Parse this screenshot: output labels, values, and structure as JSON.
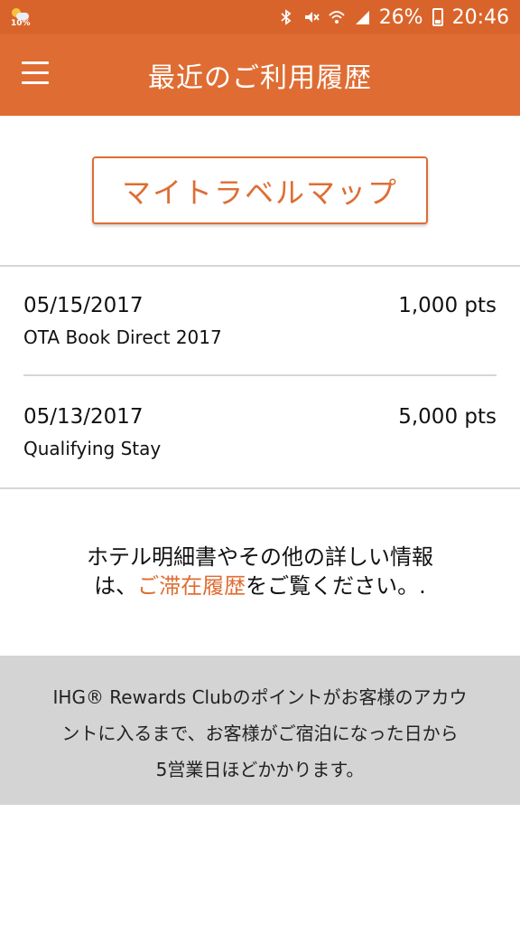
{
  "status_bar": {
    "weather_temp": "10%",
    "battery": "26%",
    "time": "20:46",
    "icons": [
      "weather-icon",
      "bluetooth-icon",
      "mute-icon",
      "wifi-icon",
      "signal-icon",
      "battery-icon"
    ]
  },
  "app_bar": {
    "title": "最近のご利用履歴",
    "menu_icon": "hamburger-menu-icon"
  },
  "map_button": {
    "label": "マイトラベルマップ"
  },
  "history": [
    {
      "date": "05/15/2017",
      "points": "1,000 pts",
      "description": "OTA Book Direct 2017"
    },
    {
      "date": "05/13/2017",
      "points": "5,000 pts",
      "description": "Qualifying Stay"
    }
  ],
  "info": {
    "line1": "ホテル明細書やその他の詳しい情報",
    "line2_prefix": "は、",
    "link": "ご滞在履歴",
    "line2_suffix": "をご覧ください。."
  },
  "note": {
    "line1": "IHG® Rewards Clubのポイントがお客様のアカウ",
    "line2": "ントに入るまで、お客様がご宿泊になった日から",
    "line3": "5営業日ほどかかります。"
  },
  "colors": {
    "accent": "#df6d33",
    "status_bar": "#d9642b",
    "note_bg": "#d4d4d4"
  }
}
